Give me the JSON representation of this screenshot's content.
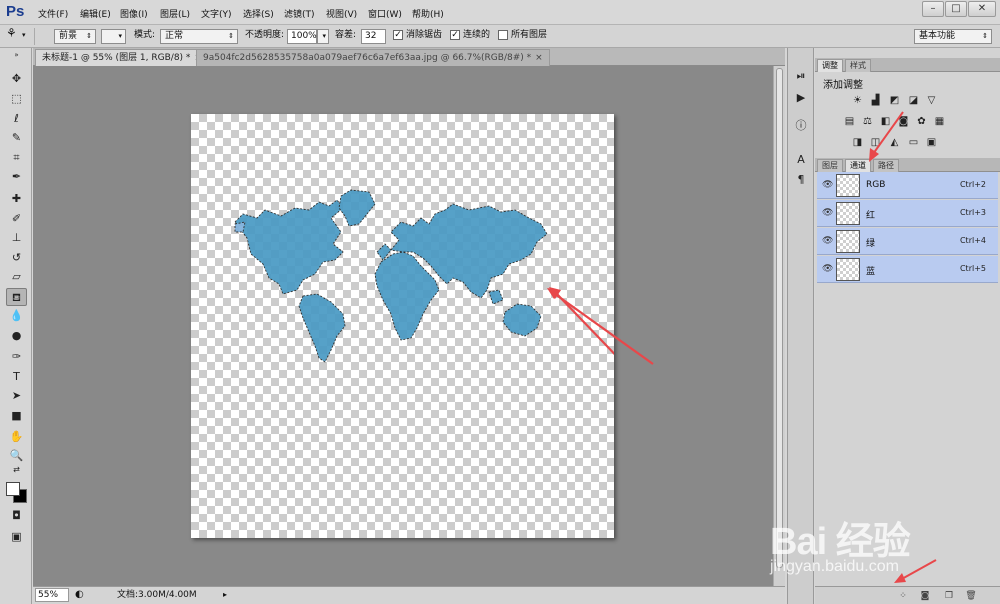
{
  "app": {
    "logo": "Ps"
  },
  "menu": [
    "文件(F)",
    "编辑(E)",
    "图像(I)",
    "图层(L)",
    "文字(Y)",
    "选择(S)",
    "滤镜(T)",
    "视图(V)",
    "窗口(W)",
    "帮助(H)"
  ],
  "window_controls": {
    "minimize": "–",
    "maximize": "□",
    "close": "✕"
  },
  "options": {
    "fill_source": "前景",
    "mode_label": "模式:",
    "mode_value": "正常",
    "opacity_label": "不透明度:",
    "opacity_value": "100%",
    "tolerance_label": "容差:",
    "tolerance_value": "32",
    "anti_alias": {
      "label": "消除锯齿",
      "checked": true
    },
    "contiguous": {
      "label": "连续的",
      "checked": true
    },
    "all_layers": {
      "label": "所有图层",
      "checked": false
    },
    "workspace": "基本功能"
  },
  "tabs": [
    {
      "label": "未标题-1 @ 55% (图层 1, RGB/8) *",
      "active": true
    },
    {
      "label": "9a504fc2d5628535758a0a079aef76c6a7ef63aa.jpg @ 66.7%(RGB/8#) *",
      "active": false
    }
  ],
  "status": {
    "zoom": "55%",
    "doc": "文档:3.00M/4.00M"
  },
  "panels": {
    "top_tabs": [
      "调整",
      "样式"
    ],
    "adjust_title": "添加调整",
    "bottom_tabs": [
      "图层",
      "通道",
      "路径"
    ],
    "active_bottom_tab": "通道"
  },
  "channels": [
    {
      "name": "RGB",
      "shortcut": "Ctrl+2"
    },
    {
      "name": "红",
      "shortcut": "Ctrl+3"
    },
    {
      "name": "绿",
      "shortcut": "Ctrl+4"
    },
    {
      "name": "蓝",
      "shortcut": "Ctrl+5"
    }
  ],
  "watermark": {
    "main": "Bai 经验",
    "sub": "jingyan.baidu.com"
  },
  "colors": {
    "map_fill": "#4a9ac4",
    "channel_selected": "#b9cbf0",
    "annotation_arrow": "#e8474a",
    "workspace_gray": "#898989"
  }
}
